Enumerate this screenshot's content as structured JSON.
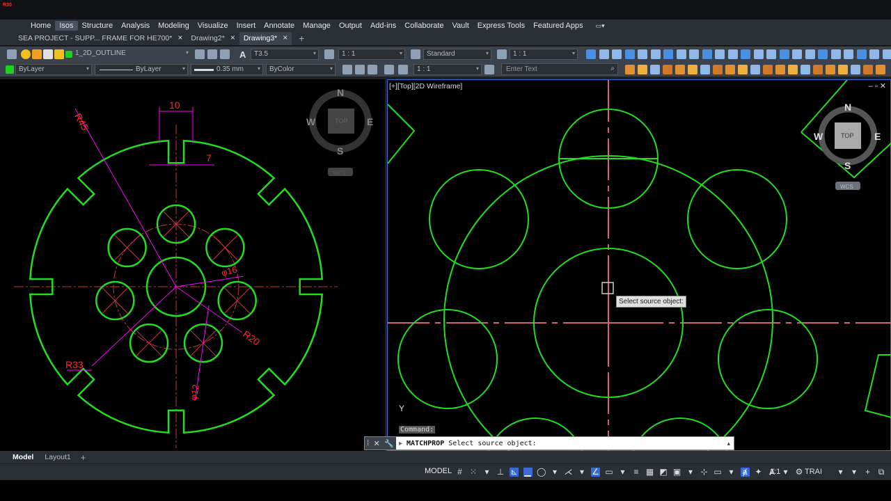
{
  "app": {
    "logo_text": "R30"
  },
  "ribbon": {
    "tabs": [
      "Home",
      "Isos",
      "Structure",
      "Analysis",
      "Modeling",
      "Visualize",
      "Insert",
      "Annotate",
      "Manage",
      "Output",
      "Add-ins",
      "Collaborate",
      "Vault",
      "Express Tools",
      "Featured Apps"
    ],
    "active_tab": "Isos"
  },
  "documents": {
    "tabs": [
      "SEA PROJECT - SUPP... FRAME FOR HE700*",
      "Drawing2*",
      "Drawing3*"
    ],
    "active_tab": "Drawing3*"
  },
  "properties": {
    "layer": "1_2D_OUTLINE",
    "color": "ByLayer",
    "linetype": "ByLayer",
    "lineweight": "0.35 mm",
    "plotstyle": "ByColor",
    "text_style": "T3.5",
    "dim_scale": "1 : 1",
    "table_style": "Standard",
    "annotation_scale": "1 : 1",
    "viewport_scale": "1 : 1",
    "search_placeholder": "Enter Text"
  },
  "left_drawing": {
    "labels": {
      "r45": "R45",
      "d10": "10",
      "d7": "7",
      "phi16": "φ16",
      "r20": "R20",
      "r33": "R33",
      "phi12": "φ12"
    },
    "viewcube": {
      "n": "N",
      "s": "S",
      "e": "E",
      "w": "W",
      "face": "TOP",
      "wcs": "WCS"
    }
  },
  "right_viewport": {
    "label": "[+][Top][2D Wireframe]",
    "viewcube": {
      "n": "N",
      "s": "S",
      "e": "E",
      "w": "W",
      "face": "TOP",
      "wcs": "WCS"
    },
    "tooltip": "Select source object:",
    "command_history_label": "Command:",
    "y_axis": "Y"
  },
  "command_line": {
    "command": "MATCHPROP",
    "prompt": "Select source object:"
  },
  "layouts": {
    "tabs": [
      "Model",
      "Layout1"
    ],
    "active_tab": "Model"
  },
  "status_bar": {
    "space": "MODEL",
    "scale": "1:1",
    "workspace": "TRAI"
  },
  "colors": {
    "geometry": "#22dd22",
    "dimension": "#ff2a2a",
    "leader": "#ff00ff",
    "center": "#cc6677",
    "accent": "#3a6bd3"
  }
}
